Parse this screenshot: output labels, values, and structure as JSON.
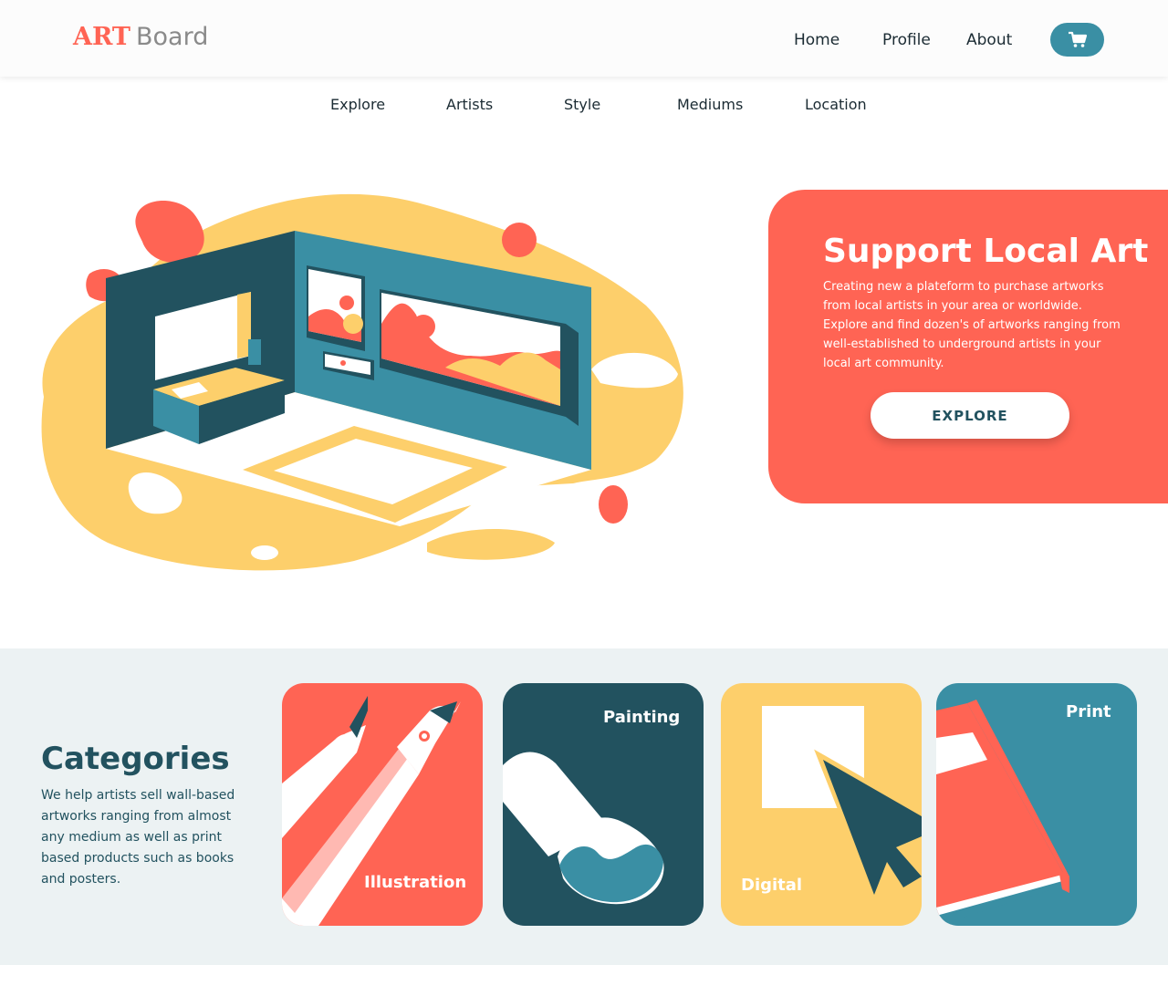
{
  "header": {
    "logo_bold": "ART",
    "logo_light": "Board",
    "nav": [
      "Home",
      "Profile",
      "About"
    ],
    "cart_icon": "shopping-cart-icon"
  },
  "subnav": [
    "Explore",
    "Artists",
    "Style",
    "Mediums",
    "Location"
  ],
  "hero": {
    "title": "Support Local Art",
    "text": "Creating new a plateform to purchase artworks from local artists in your area or worldwide. Explore and find dozen's of artworks ranging from well-established to underground artists in your local art community.",
    "button": "EXPLORE"
  },
  "categories": {
    "title": "Categories",
    "description": "We help artists sell wall-based artworks ranging from almost any medium as well as print based products such as books and posters.",
    "cards": [
      {
        "label": "Illustration",
        "icon": "pen-icon",
        "color": "#ff6454"
      },
      {
        "label": "Painting",
        "icon": "paintbrush-icon",
        "color": "#22525f"
      },
      {
        "label": "Digital",
        "icon": "cursor-icon",
        "color": "#fdcf6b"
      },
      {
        "label": "Print",
        "icon": "book-icon",
        "color": "#3a8fa4"
      }
    ]
  },
  "colors": {
    "coral": "#ff6454",
    "teal": "#3a8fa4",
    "dark_teal": "#22525f",
    "yellow": "#fdcf6b",
    "light_bg": "#ecf2f3"
  }
}
